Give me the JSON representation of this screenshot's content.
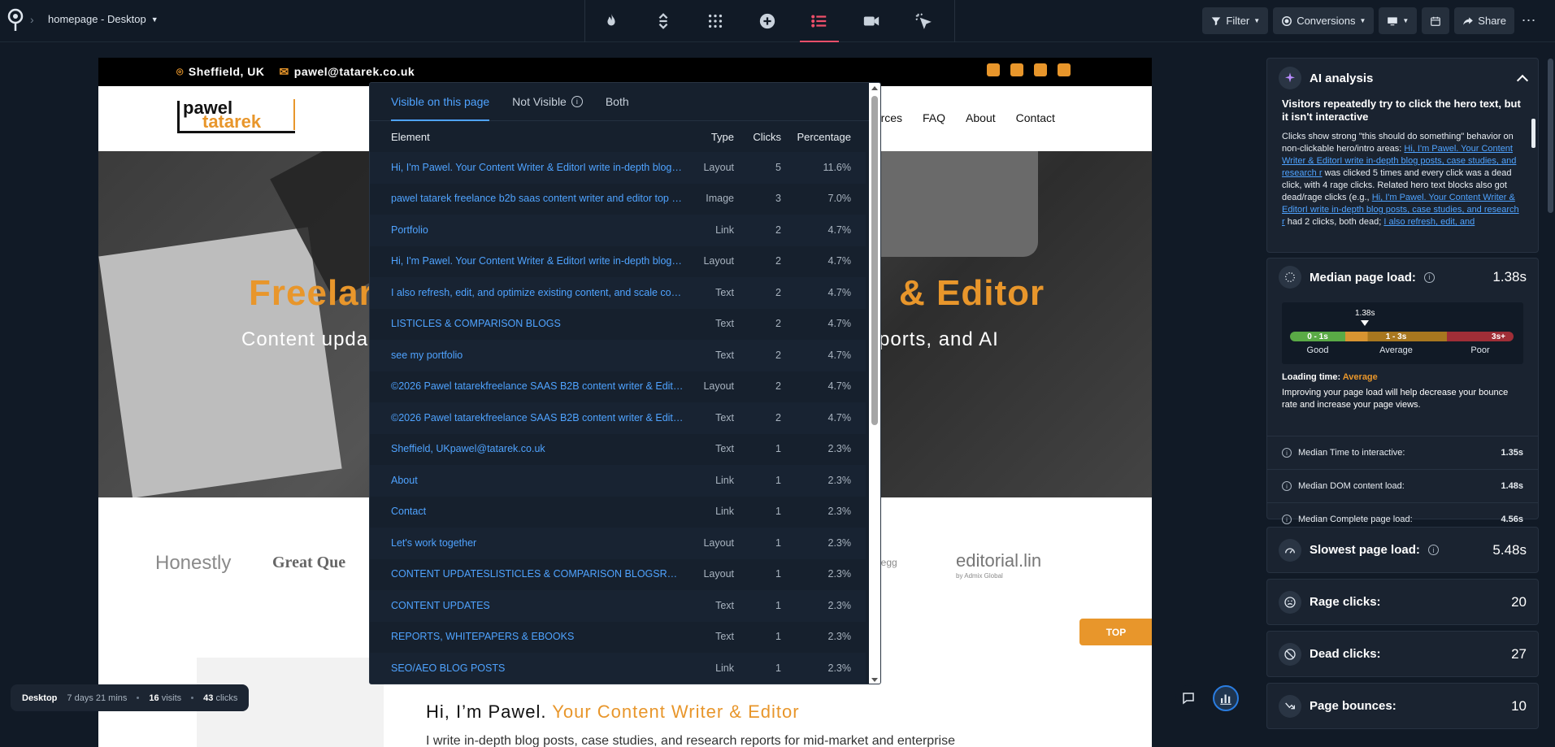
{
  "app": {
    "page_selector": "homepage - Desktop"
  },
  "toolbar": {
    "tools": [
      {
        "name": "heatmap-tool",
        "icon": "flame-icon"
      },
      {
        "name": "scrollmap-tool",
        "icon": "scroll-arrows-icon"
      },
      {
        "name": "confetti-tool",
        "icon": "grid-dots-icon"
      },
      {
        "name": "overlay-tool",
        "icon": "plus-circle-icon"
      },
      {
        "name": "list-tool",
        "icon": "list-icon",
        "active": true
      },
      {
        "name": "recordings-tool",
        "icon": "video-icon"
      },
      {
        "name": "click-tool",
        "icon": "cursor-click-icon"
      }
    ],
    "filter_label": "Filter",
    "conversions_label": "Conversions",
    "share_label": "Share",
    "accent_color": "#ef4f6a"
  },
  "site": {
    "location": "Sheffield, UK",
    "email": "pawel@tatarek.co.uk",
    "logo_line1": "pawel",
    "logo_line2": "tatarek",
    "menu": [
      "ources",
      "FAQ",
      "About",
      "Contact"
    ],
    "hero_title_left": "Freelar",
    "hero_title_right": "& Editor",
    "hero_sub_left": "Content upda",
    "hero_sub_right": "ports, and AI",
    "logos": [
      "Honestly",
      "Great Que",
      "e",
      "crazyegg",
      "editorial.lin",
      "by Admix Global"
    ],
    "top_label": "TOP",
    "hi_text": "Hi, I’m Pawel.",
    "hi_accent": "Your Content Writer & Editor",
    "hi_sub": "I write in-depth blog posts, case studies, and research reports for mid-market and enterprise",
    "brand_color": "#e8962b"
  },
  "popup": {
    "tabs": [
      "Visible on this page",
      "Not Visible",
      "Both"
    ],
    "columns": [
      "Element",
      "Type",
      "Clicks",
      "Percentage"
    ],
    "rows": [
      {
        "element": "Hi, I'm Pawel. Your Content Writer & EditorI write in-depth blog p...",
        "type": "Layout",
        "clicks": "5",
        "pct": "11.6%"
      },
      {
        "element": "pawel tatarek freelance b2b saas content writer and editor top ra...",
        "type": "Image",
        "clicks": "3",
        "pct": "7.0%"
      },
      {
        "element": "Portfolio",
        "type": "Link",
        "clicks": "2",
        "pct": "4.7%"
      },
      {
        "element": "Hi, I'm Pawel. Your Content Writer & EditorI write in-depth blog p...",
        "type": "Layout",
        "clicks": "2",
        "pct": "4.7%"
      },
      {
        "element": "I also refresh, edit, and optimize existing content, and scale cont...",
        "type": "Text",
        "clicks": "2",
        "pct": "4.7%"
      },
      {
        "element": "LISTICLES & COMPARISON BLOGS",
        "type": "Text",
        "clicks": "2",
        "pct": "4.7%"
      },
      {
        "element": "see my portfolio",
        "type": "Text",
        "clicks": "2",
        "pct": "4.7%"
      },
      {
        "element": "©2026 Pawel tatarekfreelance SAAS B2B content writer & Editor...",
        "type": "Layout",
        "clicks": "2",
        "pct": "4.7%"
      },
      {
        "element": "©2026 Pawel tatarekfreelance SAAS B2B content writer & Editor...",
        "type": "Text",
        "clicks": "2",
        "pct": "4.7%"
      },
      {
        "element": "Sheffield, UKpawel@tatarek.co.uk",
        "type": "Text",
        "clicks": "1",
        "pct": "2.3%"
      },
      {
        "element": "About",
        "type": "Link",
        "clicks": "1",
        "pct": "2.3%"
      },
      {
        "element": "Contact",
        "type": "Link",
        "clicks": "1",
        "pct": "2.3%"
      },
      {
        "element": "Let's work together",
        "type": "Layout",
        "clicks": "1",
        "pct": "2.3%"
      },
      {
        "element": "CONTENT UPDATESLISTICLES & COMPARISON BLOGSREPORT...",
        "type": "Layout",
        "clicks": "1",
        "pct": "2.3%"
      },
      {
        "element": "CONTENT UPDATES",
        "type": "Text",
        "clicks": "1",
        "pct": "2.3%"
      },
      {
        "element": "REPORTS, WHITEPAPERS & EBOOKS",
        "type": "Text",
        "clicks": "1",
        "pct": "2.3%"
      },
      {
        "element": "SEO/AEO BLOG POSTS",
        "type": "Link",
        "clicks": "1",
        "pct": "2.3%"
      }
    ]
  },
  "stats": {
    "device": "Desktop",
    "duration": "7 days 21 mins",
    "visits": "16",
    "visits_label": "visits",
    "clicks": "43",
    "clicks_label": "clicks"
  },
  "panel": {
    "ai": {
      "title": "AI analysis",
      "headline": "Visitors repeatedly try to click the hero text, but it isn't interactive",
      "p1": "Clicks show strong \"this should do something\" behavior on non-clickable hero/intro areas:",
      "link1": "Hi, I'm Pawel. Your Content Writer & EditorI write in-depth blog posts, case studies, and research r",
      "p2": "was clicked 5 times and every click was a dead click, with 4 rage clicks. Related hero text blocks also got dead/rage clicks (e.g.,",
      "link2": "Hi, I'm Pawel. Your Content Writer & EditorI write in-depth blog posts, case studies, and research r",
      "p3": "had 2 clicks, both dead;",
      "link3": "I also refresh, edit, and"
    },
    "median_load": {
      "title": "Median page load:",
      "value": "1.38s",
      "marker": "1.38s",
      "segments": [
        "0 - 1s",
        "1 - 3s",
        "3s+"
      ],
      "legend": [
        "Good",
        "Average",
        "Poor"
      ],
      "loading_label": "Loading time:",
      "loading_value": "Average",
      "desc": "Improving your page load will help decrease your bounce rate and increase your page views.",
      "metrics": [
        {
          "label": "Median Time to interactive:",
          "value": "1.35s"
        },
        {
          "label": "Median DOM content load:",
          "value": "1.48s"
        },
        {
          "label": "Median Complete page load:",
          "value": "4.56s"
        }
      ]
    },
    "slowest": {
      "title": "Slowest page load:",
      "value": "5.48s"
    },
    "rage": {
      "title": "Rage clicks:",
      "value": "20"
    },
    "dead": {
      "title": "Dead clicks:",
      "value": "27"
    },
    "bounces": {
      "title": "Page bounces:",
      "value": "10"
    }
  }
}
